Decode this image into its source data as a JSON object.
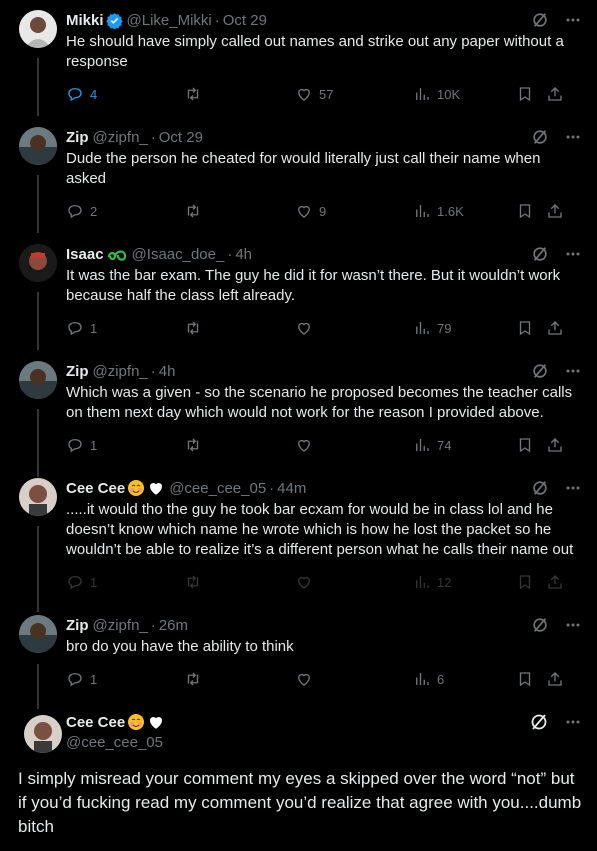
{
  "tweets": [
    {
      "name": "Mikki",
      "handle": "@Like_Mikki",
      "time": "Oct 29",
      "text": "He should have simply called out names and strike out any paper without a response",
      "replies": "4",
      "likes": "57",
      "views": "10K"
    },
    {
      "name": "Zip",
      "handle": "@zipfn_",
      "time": "Oct 29",
      "text": "Dude the person he cheated for would literally just call their name when asked",
      "replies": "2",
      "likes": "9",
      "views": "1.6K"
    },
    {
      "name": "Isaac",
      "handle": "@Isaac_doe_",
      "time": "4h",
      "text": "It was the bar exam. The guy he did it for wasn’t there. But it wouldn’t work because half the class left already.",
      "replies": "1",
      "views": "79"
    },
    {
      "name": "Zip",
      "handle": "@zipfn_",
      "time": "4h",
      "text": "Which was a given - so the scenario he proposed becomes the teacher calls on them next day which would not work for the reason I provided above.",
      "replies": "1",
      "views": "74"
    },
    {
      "name": "Cee Cee",
      "handle": "@cee_cee_05",
      "time": "44m",
      "text": ".....it would tho the guy he took bar ecxam for would be in class lol and he doesn’t know which name he wrote which is how he lost the packet so he wouldn’t be able to realize it’s a different person what he calls their name out",
      "replies": "1",
      "views": "12"
    },
    {
      "name": "Zip",
      "handle": "@zipfn_",
      "time": "26m",
      "text": "bro do you have the ability to think",
      "replies": "1",
      "views": "6"
    }
  ],
  "main": {
    "name": "Cee Cee",
    "handle": "@cee_cee_05",
    "text": "I simply misread your comment my eyes a skipped over the word “not”  but if you’d fucking read my comment you’d realize that agree with you....dumb bitch"
  },
  "separator": "·",
  "icons": [
    "grok-icon",
    "more-icon",
    "reply-icon",
    "retweet-icon",
    "like-icon",
    "views-icon",
    "bookmark-icon",
    "share-icon",
    "verified-badge-icon",
    "blush-emoji-icon",
    "white-heart-emoji-icon",
    "swirl-badge-icon"
  ],
  "colors": {
    "background": "#000000",
    "text": "#e7e9ea",
    "muted": "#71767b",
    "accent": "#1d9bf0",
    "thread_line": "#333639"
  }
}
